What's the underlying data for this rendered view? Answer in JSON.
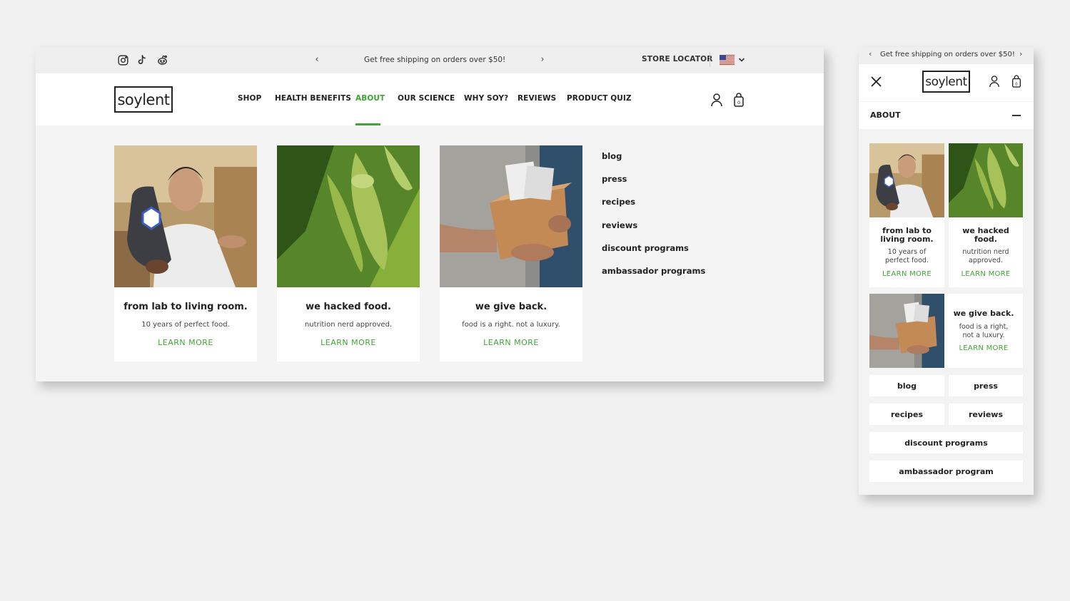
{
  "desktop": {
    "social": {
      "instagram": "instagram-icon",
      "tiktok": "tiktok-icon",
      "reddit": "reddit-icon"
    },
    "announcement": "Get free shipping on orders over $50!",
    "store_locator": "STORE LOCATOR",
    "logo": "soylent",
    "nav": [
      "SHOP",
      "HEALTH BENEFITS",
      "ABOUT",
      "OUR SCIENCE",
      "WHY SOY?",
      "REVIEWS",
      "PRODUCT QUIZ"
    ],
    "active_nav": "ABOUT",
    "cards": [
      {
        "title": "from lab to living room.",
        "subtitle": "10 years of perfect food.",
        "cta": "LEARN MORE"
      },
      {
        "title": "we hacked food.",
        "subtitle": "nutrition nerd approved.",
        "cta": "LEARN MORE"
      },
      {
        "title": "we give back.",
        "subtitle": "food is a right. not a luxury.",
        "cta": "LEARN MORE"
      }
    ],
    "links": [
      "blog",
      "press",
      "recipes",
      "reviews",
      "discount programs",
      "ambassador programs"
    ]
  },
  "mobile": {
    "announcement": "Get free shipping on orders over $50!",
    "logo": "soylent",
    "section": "ABOUT",
    "cards": [
      {
        "title_line1": "from lab to",
        "title_line2": "living room.",
        "sub_line1": "10 years of",
        "sub_line2": "perfect food.",
        "cta": "LEARN MORE"
      },
      {
        "title_line1": "we hacked",
        "title_line2": "food.",
        "sub_line1": "nutrition nerd",
        "sub_line2": "approved.",
        "cta": "LEARN MORE"
      },
      {
        "title": "we give back.",
        "sub_line1": "food is a right,",
        "sub_line2": "not a luxury.",
        "cta": "LEARN MORE"
      }
    ],
    "links": [
      "blog",
      "press",
      "recipes",
      "reviews",
      "discount programs",
      "ambassador program"
    ]
  },
  "colors": {
    "accent": "#3fa535",
    "page_bg": "#f1f1f1",
    "panel_bg": "#f4f4f4"
  }
}
